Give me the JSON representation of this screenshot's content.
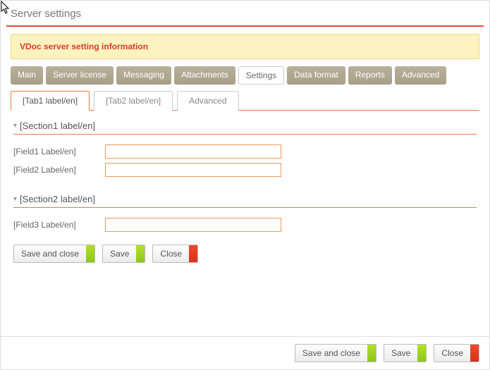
{
  "window": {
    "title": "Server settings"
  },
  "banner": {
    "text": "VDoc server setting information"
  },
  "mainTabs": {
    "items": [
      {
        "label": "Main"
      },
      {
        "label": "Server license"
      },
      {
        "label": "Messaging"
      },
      {
        "label": "Attachments"
      },
      {
        "label": "Settings"
      },
      {
        "label": "Data format"
      },
      {
        "label": "Reports"
      },
      {
        "label": "Advanced"
      }
    ],
    "activeIndex": 4
  },
  "subTabs": {
    "items": [
      {
        "label": "[Tab1 label/en]"
      },
      {
        "label": "[Tab2 label/en]"
      },
      {
        "label": "Advanced"
      }
    ],
    "activeIndex": 0
  },
  "sections": [
    {
      "title": "[Section1 label/en]",
      "fields": [
        {
          "label": "[Field1 Label/en]",
          "value": ""
        },
        {
          "label": "[Field2 Label/en]",
          "value": ""
        }
      ]
    },
    {
      "title": "[Section2 label/en]",
      "fields": [
        {
          "label": "[Field3 Label/en]",
          "value": ""
        }
      ]
    }
  ],
  "buttons": {
    "saveAndClose": "Save and close",
    "save": "Save",
    "close": "Close"
  }
}
